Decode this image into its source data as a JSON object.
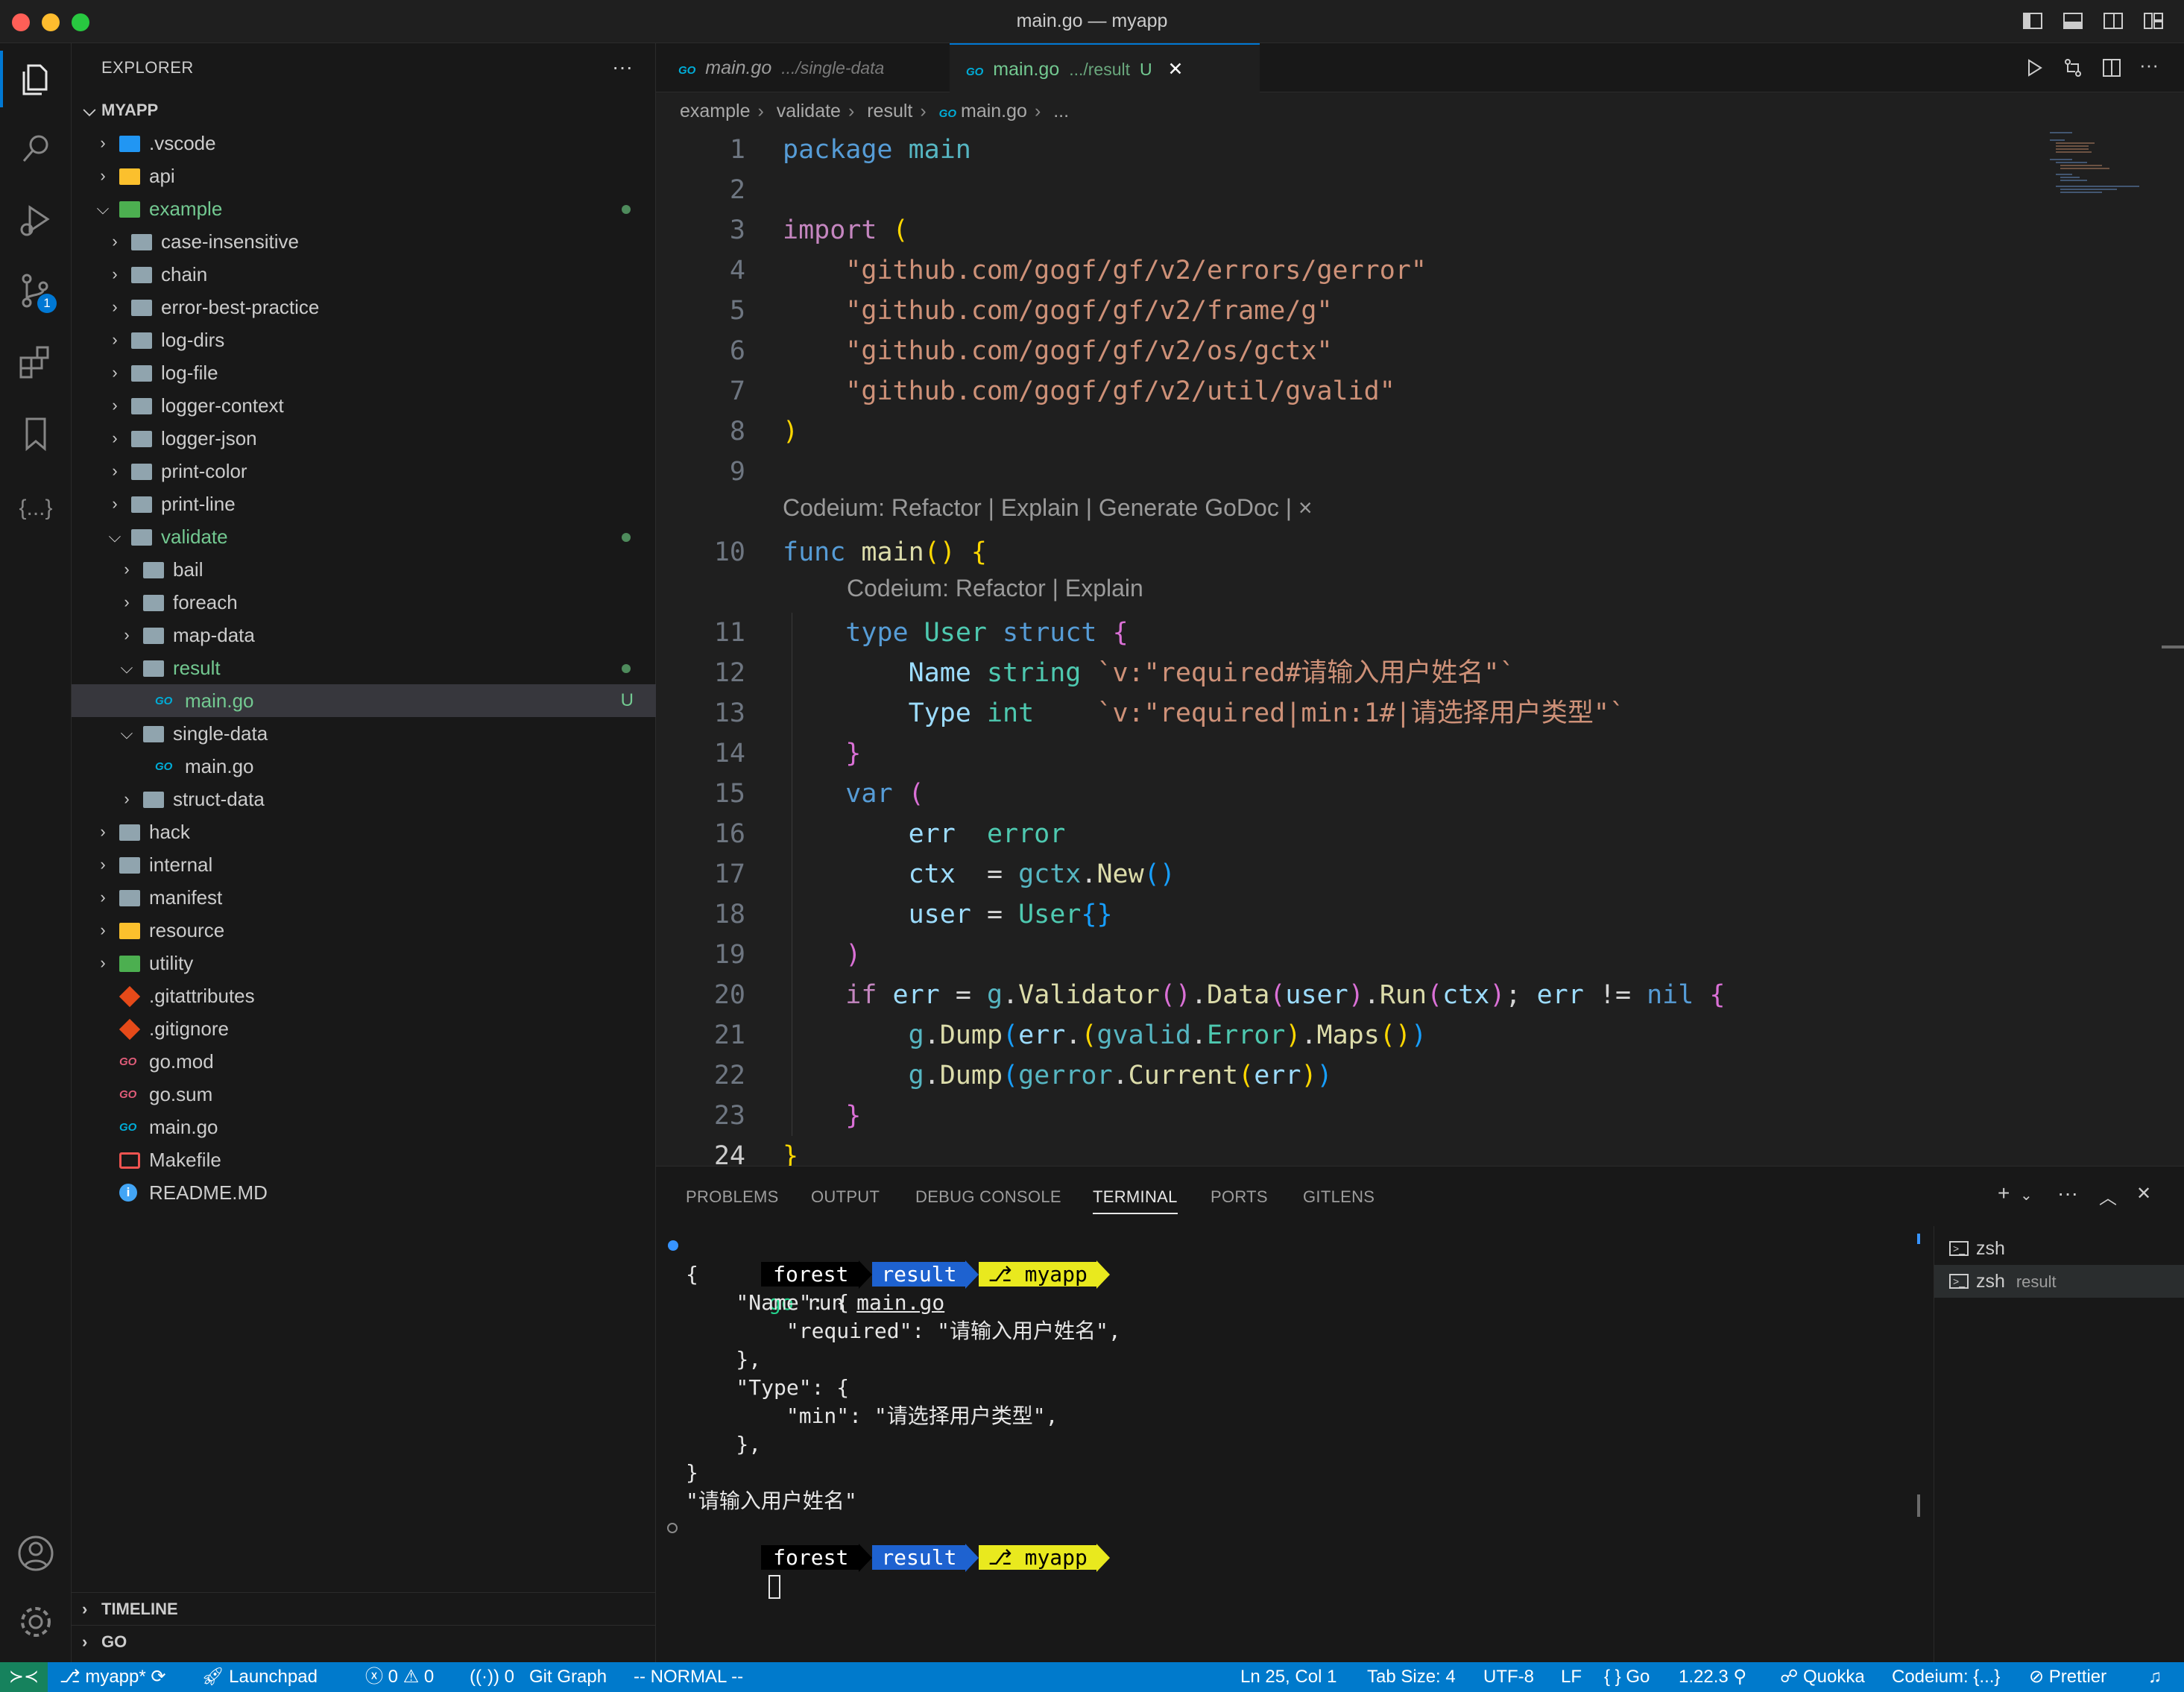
{
  "window": {
    "title": "main.go — myapp",
    "colors": {
      "close": "#ff5f57",
      "minimize": "#febc2e",
      "maximize": "#28c840"
    }
  },
  "activity": {
    "scm_badge": "1"
  },
  "explorer": {
    "title": "EXPLORER",
    "more": "···",
    "root": "MYAPP",
    "items": [
      {
        "label": ".vscode",
        "depth": 1,
        "kind": "folder-vscode",
        "open": false
      },
      {
        "label": "api",
        "depth": 1,
        "kind": "folder-yellow",
        "open": false
      },
      {
        "label": "example",
        "depth": 1,
        "kind": "folder-green",
        "open": true,
        "dot": true,
        "color": "#73c991"
      },
      {
        "label": "case-insensitive",
        "depth": 2,
        "kind": "folder",
        "open": false
      },
      {
        "label": "chain",
        "depth": 2,
        "kind": "folder",
        "open": false
      },
      {
        "label": "error-best-practice",
        "depth": 2,
        "kind": "folder",
        "open": false
      },
      {
        "label": "log-dirs",
        "depth": 2,
        "kind": "folder",
        "open": false
      },
      {
        "label": "log-file",
        "depth": 2,
        "kind": "folder",
        "open": false
      },
      {
        "label": "logger-context",
        "depth": 2,
        "kind": "folder",
        "open": false
      },
      {
        "label": "logger-json",
        "depth": 2,
        "kind": "folder",
        "open": false
      },
      {
        "label": "print-color",
        "depth": 2,
        "kind": "folder",
        "open": false
      },
      {
        "label": "print-line",
        "depth": 2,
        "kind": "folder",
        "open": false
      },
      {
        "label": "validate",
        "depth": 2,
        "kind": "folder-open",
        "open": true,
        "dot": true,
        "color": "#73c991"
      },
      {
        "label": "bail",
        "depth": 3,
        "kind": "folder",
        "open": false
      },
      {
        "label": "foreach",
        "depth": 3,
        "kind": "folder",
        "open": false
      },
      {
        "label": "map-data",
        "depth": 3,
        "kind": "folder",
        "open": false
      },
      {
        "label": "result",
        "depth": 3,
        "kind": "folder-open",
        "open": true,
        "dot": true,
        "color": "#73c991"
      },
      {
        "label": "main.go",
        "depth": 4,
        "kind": "go",
        "selected": true,
        "u": "U",
        "color": "#73c991"
      },
      {
        "label": "single-data",
        "depth": 3,
        "kind": "folder-open",
        "open": true
      },
      {
        "label": "main.go",
        "depth": 4,
        "kind": "go"
      },
      {
        "label": "struct-data",
        "depth": 3,
        "kind": "folder",
        "open": false
      },
      {
        "label": "hack",
        "depth": 1,
        "kind": "folder",
        "open": false
      },
      {
        "label": "internal",
        "depth": 1,
        "kind": "folder",
        "open": false
      },
      {
        "label": "manifest",
        "depth": 1,
        "kind": "folder",
        "open": false
      },
      {
        "label": "resource",
        "depth": 1,
        "kind": "folder-yellow",
        "open": false
      },
      {
        "label": "utility",
        "depth": 1,
        "kind": "folder-green",
        "open": false
      },
      {
        "label": ".gitattributes",
        "depth": 1,
        "kind": "git"
      },
      {
        "label": ".gitignore",
        "depth": 1,
        "kind": "git"
      },
      {
        "label": "go.mod",
        "depth": 1,
        "kind": "gomod"
      },
      {
        "label": "go.sum",
        "depth": 1,
        "kind": "gomod"
      },
      {
        "label": "main.go",
        "depth": 1,
        "kind": "go"
      },
      {
        "label": "Makefile",
        "depth": 1,
        "kind": "makefile"
      },
      {
        "label": "README.MD",
        "depth": 1,
        "kind": "info"
      }
    ],
    "timeline": "TIMELINE",
    "go_section": "GO"
  },
  "tabs": [
    {
      "badge": "GO",
      "name": "main.go",
      "path": ".../single-data",
      "active": false
    },
    {
      "badge": "GO",
      "name": "main.go",
      "path": ".../result",
      "status": "U",
      "active": true,
      "close": "✕"
    }
  ],
  "breadcrumb": [
    "example",
    "validate",
    "result",
    "main.go",
    "..."
  ],
  "code": {
    "lens1": "Codeium: Refactor | Explain | Generate GoDoc | ×",
    "lens2": "Codeium: Refactor | Explain",
    "line_numbers": [
      "1",
      "2",
      "3",
      "4",
      "5",
      "6",
      "7",
      "8",
      "9",
      "10",
      "11",
      "12",
      "13",
      "14",
      "15",
      "16",
      "17",
      "18",
      "19",
      "20",
      "21",
      "22",
      "23",
      "24"
    ],
    "lines": [
      [
        [
          "kw",
          "package"
        ],
        [
          "plain",
          " "
        ],
        [
          "pk",
          "main"
        ]
      ],
      [],
      [
        [
          "kw2",
          "import"
        ],
        [
          "plain",
          " "
        ],
        [
          "p1",
          "("
        ]
      ],
      [
        [
          "plain",
          "    "
        ],
        [
          "str",
          "\"github.com/gogf/gf/v2/errors/gerror\""
        ]
      ],
      [
        [
          "plain",
          "    "
        ],
        [
          "str",
          "\"github.com/gogf/gf/v2/frame/g\""
        ]
      ],
      [
        [
          "plain",
          "    "
        ],
        [
          "str",
          "\"github.com/gogf/gf/v2/os/gctx\""
        ]
      ],
      [
        [
          "plain",
          "    "
        ],
        [
          "str",
          "\"github.com/gogf/gf/v2/util/gvalid\""
        ]
      ],
      [
        [
          "p1",
          ")"
        ]
      ],
      [],
      [
        [
          "kw",
          "func"
        ],
        [
          "plain",
          " "
        ],
        [
          "fn",
          "main"
        ],
        [
          "p1",
          "()"
        ],
        [
          "plain",
          " "
        ],
        [
          "p1",
          "{"
        ]
      ],
      [
        [
          "plain",
          "    "
        ],
        [
          "kw",
          "type"
        ],
        [
          "plain",
          " "
        ],
        [
          "ty",
          "User"
        ],
        [
          "plain",
          " "
        ],
        [
          "kw",
          "struct"
        ],
        [
          "plain",
          " "
        ],
        [
          "p2",
          "{"
        ]
      ],
      [
        [
          "plain",
          "        "
        ],
        [
          "var",
          "Name"
        ],
        [
          "plain",
          " "
        ],
        [
          "ty",
          "string"
        ],
        [
          "plain",
          " "
        ],
        [
          "str",
          "`v:\"required#请输入用户姓名\"`"
        ]
      ],
      [
        [
          "plain",
          "        "
        ],
        [
          "var",
          "Type"
        ],
        [
          "plain",
          " "
        ],
        [
          "ty",
          "int"
        ],
        [
          "plain",
          "    "
        ],
        [
          "str",
          "`v:\"required|min:1#|请选择用户类型\"`"
        ]
      ],
      [
        [
          "plain",
          "    "
        ],
        [
          "p2",
          "}"
        ]
      ],
      [
        [
          "plain",
          "    "
        ],
        [
          "kw",
          "var"
        ],
        [
          "plain",
          " "
        ],
        [
          "p2",
          "("
        ]
      ],
      [
        [
          "plain",
          "        "
        ],
        [
          "var",
          "err"
        ],
        [
          "plain",
          "  "
        ],
        [
          "ty",
          "error"
        ]
      ],
      [
        [
          "plain",
          "        "
        ],
        [
          "var",
          "ctx"
        ],
        [
          "plain",
          "  = "
        ],
        [
          "pk",
          "gctx"
        ],
        [
          "plain",
          "."
        ],
        [
          "fn",
          "New"
        ],
        [
          "p3",
          "()"
        ]
      ],
      [
        [
          "plain",
          "        "
        ],
        [
          "var",
          "user"
        ],
        [
          "plain",
          " = "
        ],
        [
          "ty",
          "User"
        ],
        [
          "p3",
          "{}"
        ]
      ],
      [
        [
          "plain",
          "    "
        ],
        [
          "p2",
          ")"
        ]
      ],
      [
        [
          "plain",
          "    "
        ],
        [
          "kw2",
          "if"
        ],
        [
          "plain",
          " "
        ],
        [
          "var",
          "err"
        ],
        [
          "plain",
          " = "
        ],
        [
          "pk",
          "g"
        ],
        [
          "plain",
          "."
        ],
        [
          "fn",
          "Validator"
        ],
        [
          "p2",
          "()"
        ],
        [
          "plain",
          "."
        ],
        [
          "fn",
          "Data"
        ],
        [
          "p2",
          "("
        ],
        [
          "var",
          "user"
        ],
        [
          "p2",
          ")"
        ],
        [
          "plain",
          "."
        ],
        [
          "fn",
          "Run"
        ],
        [
          "p2",
          "("
        ],
        [
          "var",
          "ctx"
        ],
        [
          "p2",
          ")"
        ],
        [
          "plain",
          "; "
        ],
        [
          "var",
          "err"
        ],
        [
          "plain",
          " != "
        ],
        [
          "kw",
          "nil"
        ],
        [
          "plain",
          " "
        ],
        [
          "p2",
          "{"
        ]
      ],
      [
        [
          "plain",
          "        "
        ],
        [
          "pk",
          "g"
        ],
        [
          "plain",
          "."
        ],
        [
          "fn",
          "Dump"
        ],
        [
          "p3",
          "("
        ],
        [
          "var",
          "err"
        ],
        [
          "plain",
          "."
        ],
        [
          "p1",
          "("
        ],
        [
          "pk",
          "gvalid"
        ],
        [
          "plain",
          "."
        ],
        [
          "ty",
          "Error"
        ],
        [
          "p1",
          ")"
        ],
        [
          "plain",
          "."
        ],
        [
          "fn",
          "Maps"
        ],
        [
          "p1",
          "()"
        ],
        [
          "p3",
          ")"
        ]
      ],
      [
        [
          "plain",
          "        "
        ],
        [
          "pk",
          "g"
        ],
        [
          "plain",
          "."
        ],
        [
          "fn",
          "Dump"
        ],
        [
          "p3",
          "("
        ],
        [
          "pk",
          "gerror"
        ],
        [
          "plain",
          "."
        ],
        [
          "fn",
          "Current"
        ],
        [
          "p1",
          "("
        ],
        [
          "var",
          "err"
        ],
        [
          "p1",
          ")"
        ],
        [
          "p3",
          ")"
        ]
      ],
      [
        [
          "plain",
          "    "
        ],
        [
          "p2",
          "}"
        ]
      ],
      [
        [
          "p1",
          "}"
        ]
      ]
    ]
  },
  "panel": {
    "tabs": [
      "PROBLEMS",
      "OUTPUT",
      "DEBUG CONSOLE",
      "TERMINAL",
      "PORTS",
      "GITLENS"
    ],
    "active_tab": "TERMINAL",
    "prompt": {
      "user": "forest",
      "dir": "result",
      "branch": "myapp",
      "branch_icon": ""
    },
    "command": {
      "cmd": "go",
      "rest": " run ",
      "file": "main.go"
    },
    "output": [
      "{",
      "    \"Name\": {",
      "        \"required\": \"请输入用户姓名\",",
      "    },",
      "    \"Type\": {",
      "        \"min\": \"请选择用户类型\",",
      "    },",
      "}",
      "\"请输入用户姓名\""
    ],
    "terminals": [
      {
        "name": "zsh",
        "detail": ""
      },
      {
        "name": "zsh",
        "detail": "result"
      }
    ]
  },
  "statusbar": {
    "branch": "myapp*",
    "launchpad": "Launchpad",
    "errors": "0",
    "warnings": "0",
    "ports": "0",
    "git_graph": "Git Graph",
    "mode": "-- NORMAL --",
    "position": "Ln 25, Col 1",
    "tab_size": "Tab Size: 4",
    "encoding": "UTF-8",
    "eol": "LF",
    "language": "Go",
    "go_version": "1.22.3",
    "quokka": "Quokka",
    "codeium": "Codeium: {...}",
    "prettier": "Prettier"
  }
}
